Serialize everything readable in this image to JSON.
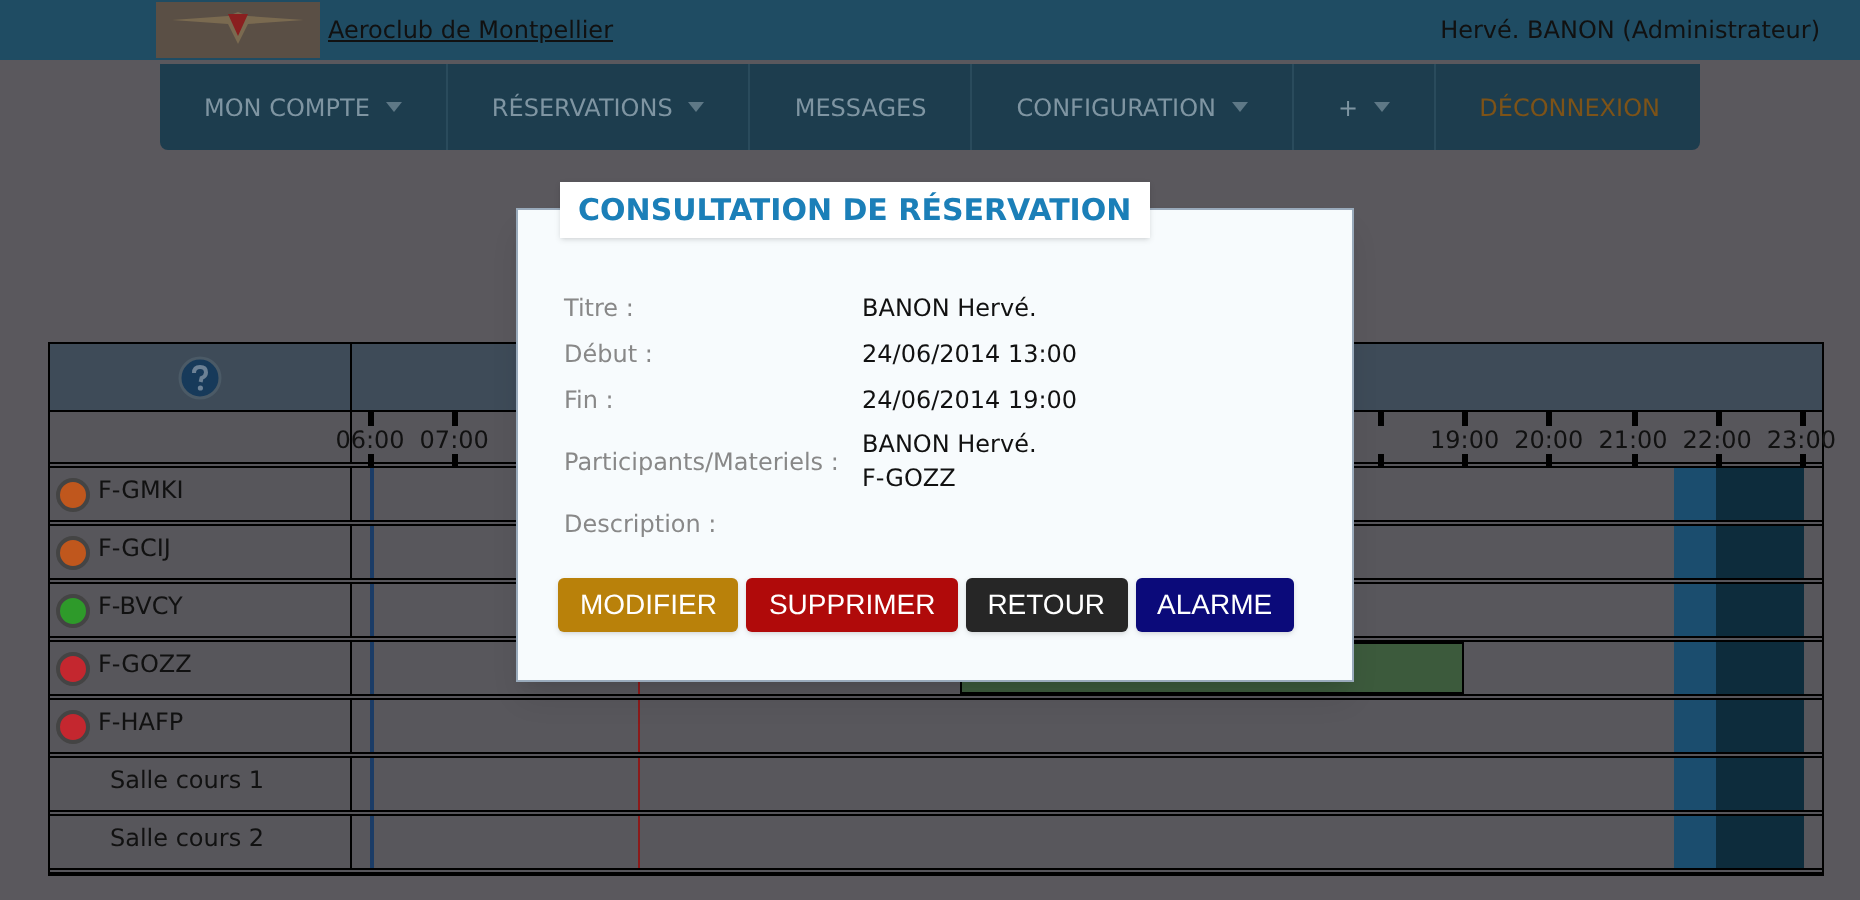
{
  "header": {
    "site_link": "Aeroclub de Montpellier",
    "user": "Hervé. BANON (Administrateur)"
  },
  "nav": {
    "items": [
      {
        "label": "MON COMPTE",
        "dropdown": true
      },
      {
        "label": "RÉSERVATIONS",
        "dropdown": true
      },
      {
        "label": "MESSAGES",
        "dropdown": false
      },
      {
        "label": "CONFIGURATION",
        "dropdown": true
      },
      {
        "label": "+",
        "dropdown": true
      }
    ],
    "logout": "DÉCONNEXION"
  },
  "planning": {
    "hours_left": [
      "06:00",
      "07:00"
    ],
    "hours_right": [
      "19:00",
      "20:00",
      "21:00",
      "22:00",
      "23:00"
    ],
    "rows": [
      {
        "name": "F-GMKI",
        "kind": "aircraft",
        "color": "#c0571d",
        "reserved": false
      },
      {
        "name": "F-GCIJ",
        "kind": "aircraft",
        "color": "#c0571d",
        "reserved": false
      },
      {
        "name": "F-BVCY",
        "kind": "aircraft",
        "color": "#2e9a2a",
        "reserved": false
      },
      {
        "name": "F-GOZZ",
        "kind": "aircraft",
        "color": "#c4272f",
        "reserved": true
      },
      {
        "name": "F-HAFP",
        "kind": "aircraft",
        "color": "#c4272f",
        "reserved": false
      },
      {
        "name": "Salle cours 1",
        "kind": "room",
        "reserved": false
      },
      {
        "name": "Salle cours 2",
        "kind": "room",
        "reserved": false
      }
    ]
  },
  "dialog": {
    "title": "CONSULTATION DE RÉSERVATION",
    "fields": [
      {
        "label": "Titre :",
        "values": [
          "BANON Hervé."
        ]
      },
      {
        "label": "Début :",
        "values": [
          "24/06/2014 13:00"
        ]
      },
      {
        "label": "Fin :",
        "values": [
          "24/06/2014 19:00"
        ]
      },
      {
        "label": "Participants/Materiels :",
        "values": [
          "BANON Hervé.",
          "F-GOZZ"
        ]
      },
      {
        "label": "Description :"
      }
    ],
    "buttons": [
      {
        "label": "MODIFIER",
        "kind": "edit"
      },
      {
        "label": "SUPPRIMER",
        "kind": "delete"
      },
      {
        "label": "RETOUR",
        "kind": "back"
      },
      {
        "label": "ALARME",
        "kind": "alarm"
      }
    ]
  }
}
